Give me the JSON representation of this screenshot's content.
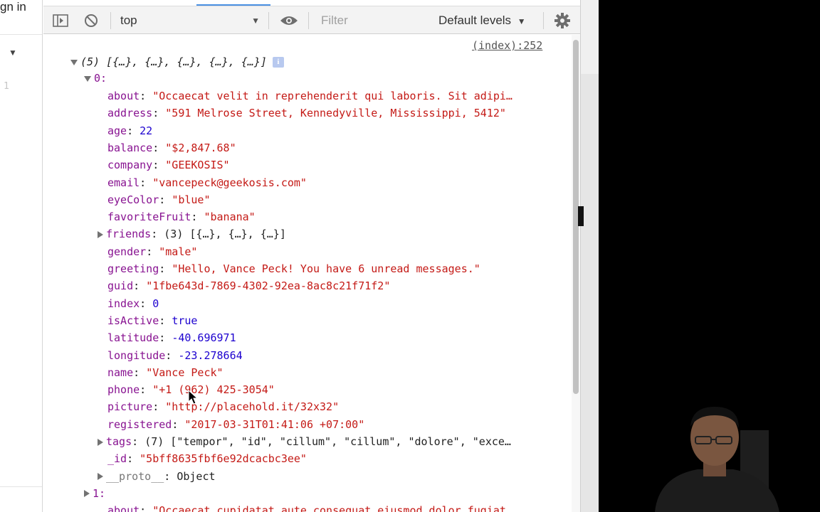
{
  "page": {
    "signin_fragment": "gn in",
    "caret": "▼",
    "line_number": "1"
  },
  "toolbar": {
    "context": "top",
    "filter_placeholder": "Filter",
    "levels": "Default levels"
  },
  "console": {
    "source_link": "(index):252",
    "array_summary": "(5) [{…}, {…}, {…}, {…}, {…}]",
    "item0_label": "0:",
    "fields": [
      {
        "key": "about",
        "value": "\"Occaecat velit in reprehenderit qui laboris. Sit adipi…",
        "type": "str"
      },
      {
        "key": "address",
        "value": "\"591 Melrose Street, Kennedyville, Mississippi, 5412\"",
        "type": "str"
      },
      {
        "key": "age",
        "value": "22",
        "type": "num"
      },
      {
        "key": "balance",
        "value": "\"$2,847.68\"",
        "type": "str"
      },
      {
        "key": "company",
        "value": "\"GEEKOSIS\"",
        "type": "str"
      },
      {
        "key": "email",
        "value": "\"vancepeck@geekosis.com\"",
        "type": "str"
      },
      {
        "key": "eyeColor",
        "value": "\"blue\"",
        "type": "str"
      },
      {
        "key": "favoriteFruit",
        "value": "\"banana\"",
        "type": "str"
      },
      {
        "key": "friends",
        "value": "(3) [{…}, {…}, {…}]",
        "type": "expand"
      },
      {
        "key": "gender",
        "value": "\"male\"",
        "type": "str"
      },
      {
        "key": "greeting",
        "value": "\"Hello, Vance Peck! You have 6 unread messages.\"",
        "type": "str"
      },
      {
        "key": "guid",
        "value": "\"1fbe643d-7869-4302-92ea-8ac8c21f71f2\"",
        "type": "str"
      },
      {
        "key": "index",
        "value": "0",
        "type": "num"
      },
      {
        "key": "isActive",
        "value": "true",
        "type": "num"
      },
      {
        "key": "latitude",
        "value": "-40.696971",
        "type": "num"
      },
      {
        "key": "longitude",
        "value": "-23.278664",
        "type": "num"
      },
      {
        "key": "name",
        "value": "\"Vance Peck\"",
        "type": "str"
      },
      {
        "key": "phone",
        "value": "\"+1 (962) 425-3054\"",
        "type": "str"
      },
      {
        "key": "picture",
        "value": "\"http://placehold.it/32x32\"",
        "type": "str"
      },
      {
        "key": "registered",
        "value": "\"2017-03-31T01:41:06 +07:00\"",
        "type": "str"
      },
      {
        "key": "tags",
        "value": "(7) [\"tempor\", \"id\", \"cillum\", \"cillum\", \"dolore\", \"exce…",
        "type": "expand"
      },
      {
        "key": "_id",
        "value": "\"5bff8635fbf6e92dcacbc3ee\"",
        "type": "str"
      },
      {
        "key": "__proto__",
        "value": "Object",
        "type": "proto"
      }
    ],
    "item1_label": "1:",
    "item1_about": "\"Occaecat cupidatat aute consequat eiusmod dolor fugiat…"
  }
}
